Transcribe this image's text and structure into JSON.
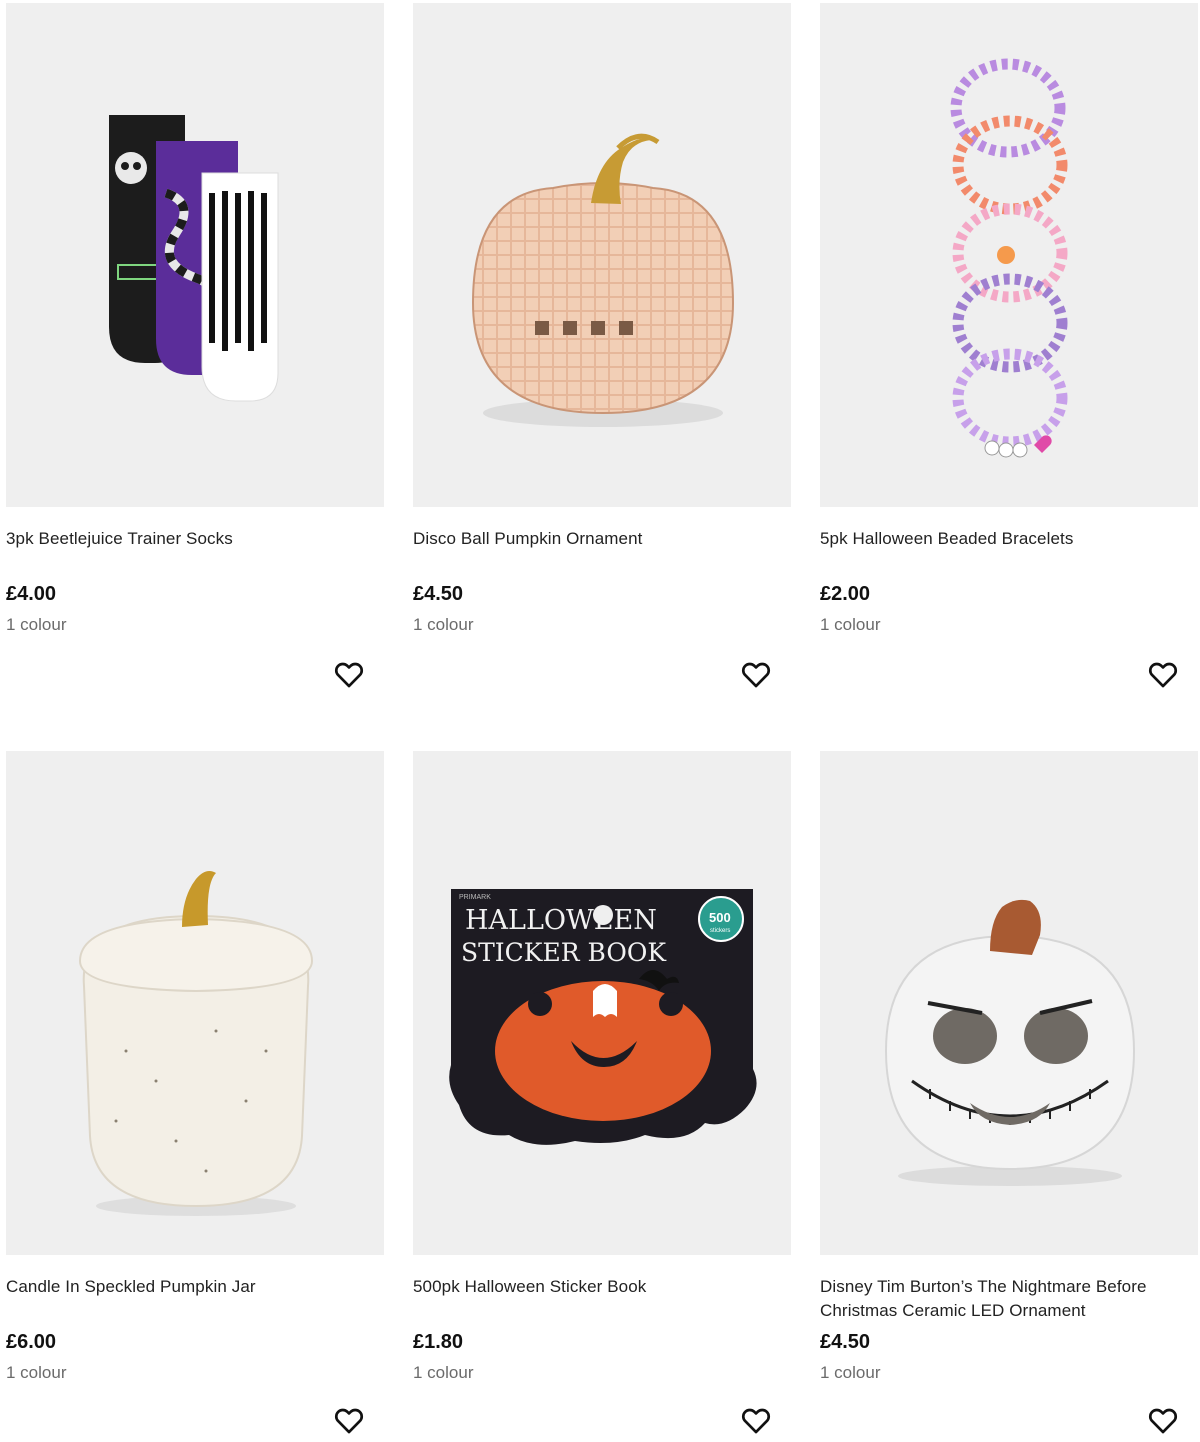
{
  "products": [
    {
      "name": "3pk Beetlejuice Trainer Socks",
      "price": "£4.00",
      "colours": "1 colour",
      "image_icon": "socks-image"
    },
    {
      "name": "Disco Ball Pumpkin Ornament",
      "price": "£4.50",
      "colours": "1 colour",
      "image_icon": "disco-pumpkin-image"
    },
    {
      "name": "5pk Halloween Beaded Bracelets",
      "price": "£2.00",
      "colours": "1 colour",
      "image_icon": "bracelets-image"
    },
    {
      "name": "Candle In Speckled Pumpkin Jar",
      "price": "£6.00",
      "colours": "1 colour",
      "image_icon": "pumpkin-candle-image"
    },
    {
      "name": "500pk Halloween Sticker Book",
      "price": "£1.80",
      "colours": "1 colour",
      "image_icon": "sticker-book-image",
      "image_text": {
        "title_line1": "HALLOWEEN",
        "title_line2": "STICKER BOOK",
        "badge_number": "500",
        "badge_word": "stickers",
        "brand": "PRIMARK"
      }
    },
    {
      "name": "Disney Tim Burton’s The Nightmare Before Christmas Ceramic LED Ornament",
      "price": "£4.50",
      "colours": "1 colour",
      "image_icon": "jack-pumpkin-image"
    }
  ],
  "icons": {
    "favourite": "heart-outline-icon"
  },
  "colors": {
    "image_background": "#efefef",
    "text": "#222222",
    "muted_text": "#6b6b6b"
  }
}
